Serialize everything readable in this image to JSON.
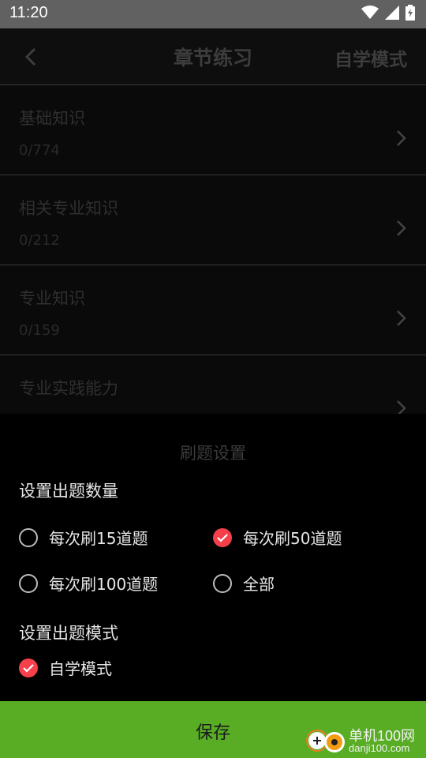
{
  "status": {
    "time": "11:20"
  },
  "header": {
    "title": "章节练习",
    "mode": "自学模式"
  },
  "chapters": [
    {
      "name": "基础知识",
      "count": "0/774"
    },
    {
      "name": "相关专业知识",
      "count": "0/212"
    },
    {
      "name": "专业知识",
      "count": "0/159"
    },
    {
      "name": "专业实践能力",
      "count": ""
    }
  ],
  "sheet": {
    "title": "刷题设置",
    "count_section": "设置出题数量",
    "count_options": [
      {
        "label": "每次刷15道题",
        "checked": false
      },
      {
        "label": "每次刷50道题",
        "checked": true
      },
      {
        "label": "每次刷100道题",
        "checked": false
      },
      {
        "label": "全部",
        "checked": false
      }
    ],
    "mode_section": "设置出题模式",
    "mode_options": [
      {
        "label": "自学模式",
        "checked": true
      }
    ],
    "save_label": "保存"
  },
  "watermark": {
    "line1": "单机100网",
    "line2": "danji100.com"
  },
  "colors": {
    "accent_red": "#f53f4b",
    "save_green": "#58ad25"
  }
}
